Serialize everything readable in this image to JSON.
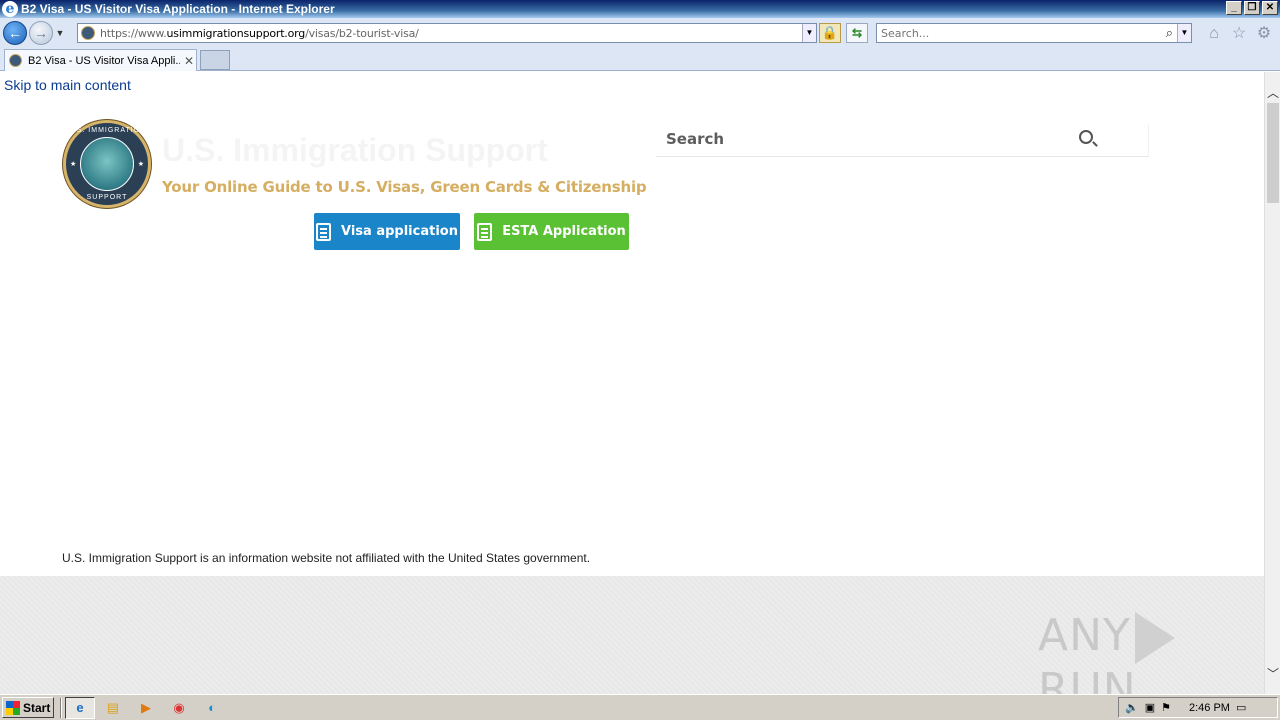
{
  "window": {
    "title": "B2 Visa - US Visitor Visa Application - Internet Explorer"
  },
  "address": {
    "url_prefix": "https://www.",
    "url_domain": "usimmigrationsupport.org",
    "url_path": "/visas/b2-tourist-visa/"
  },
  "browser_search": {
    "placeholder": "Search..."
  },
  "tabs": [
    {
      "label": "B2 Visa - US Visitor Visa Appli..."
    }
  ],
  "page": {
    "skip_link": "Skip to main content",
    "logo": {
      "top_text": "U.S. IMMIGRATION",
      "bottom_text": "SUPPORT"
    },
    "site_title": "U.S. Immigration Support",
    "tagline": "Your Online Guide to U.S. Visas, Green Cards & Citizenship",
    "buttons": {
      "visa": "Visa application",
      "esta": "ESTA Application"
    },
    "search": {
      "placeholder": "Search"
    },
    "disclaimer": "U.S. Immigration Support is an information website not affiliated with the United States government."
  },
  "watermark": {
    "left": "ANY",
    "right": "RUN"
  },
  "taskbar": {
    "start_label": "Start",
    "clock": "2:46 PM"
  },
  "colors": {
    "visa_button": "#1a85c9",
    "esta_button": "#5ac034",
    "tagline": "#d5ae62"
  }
}
